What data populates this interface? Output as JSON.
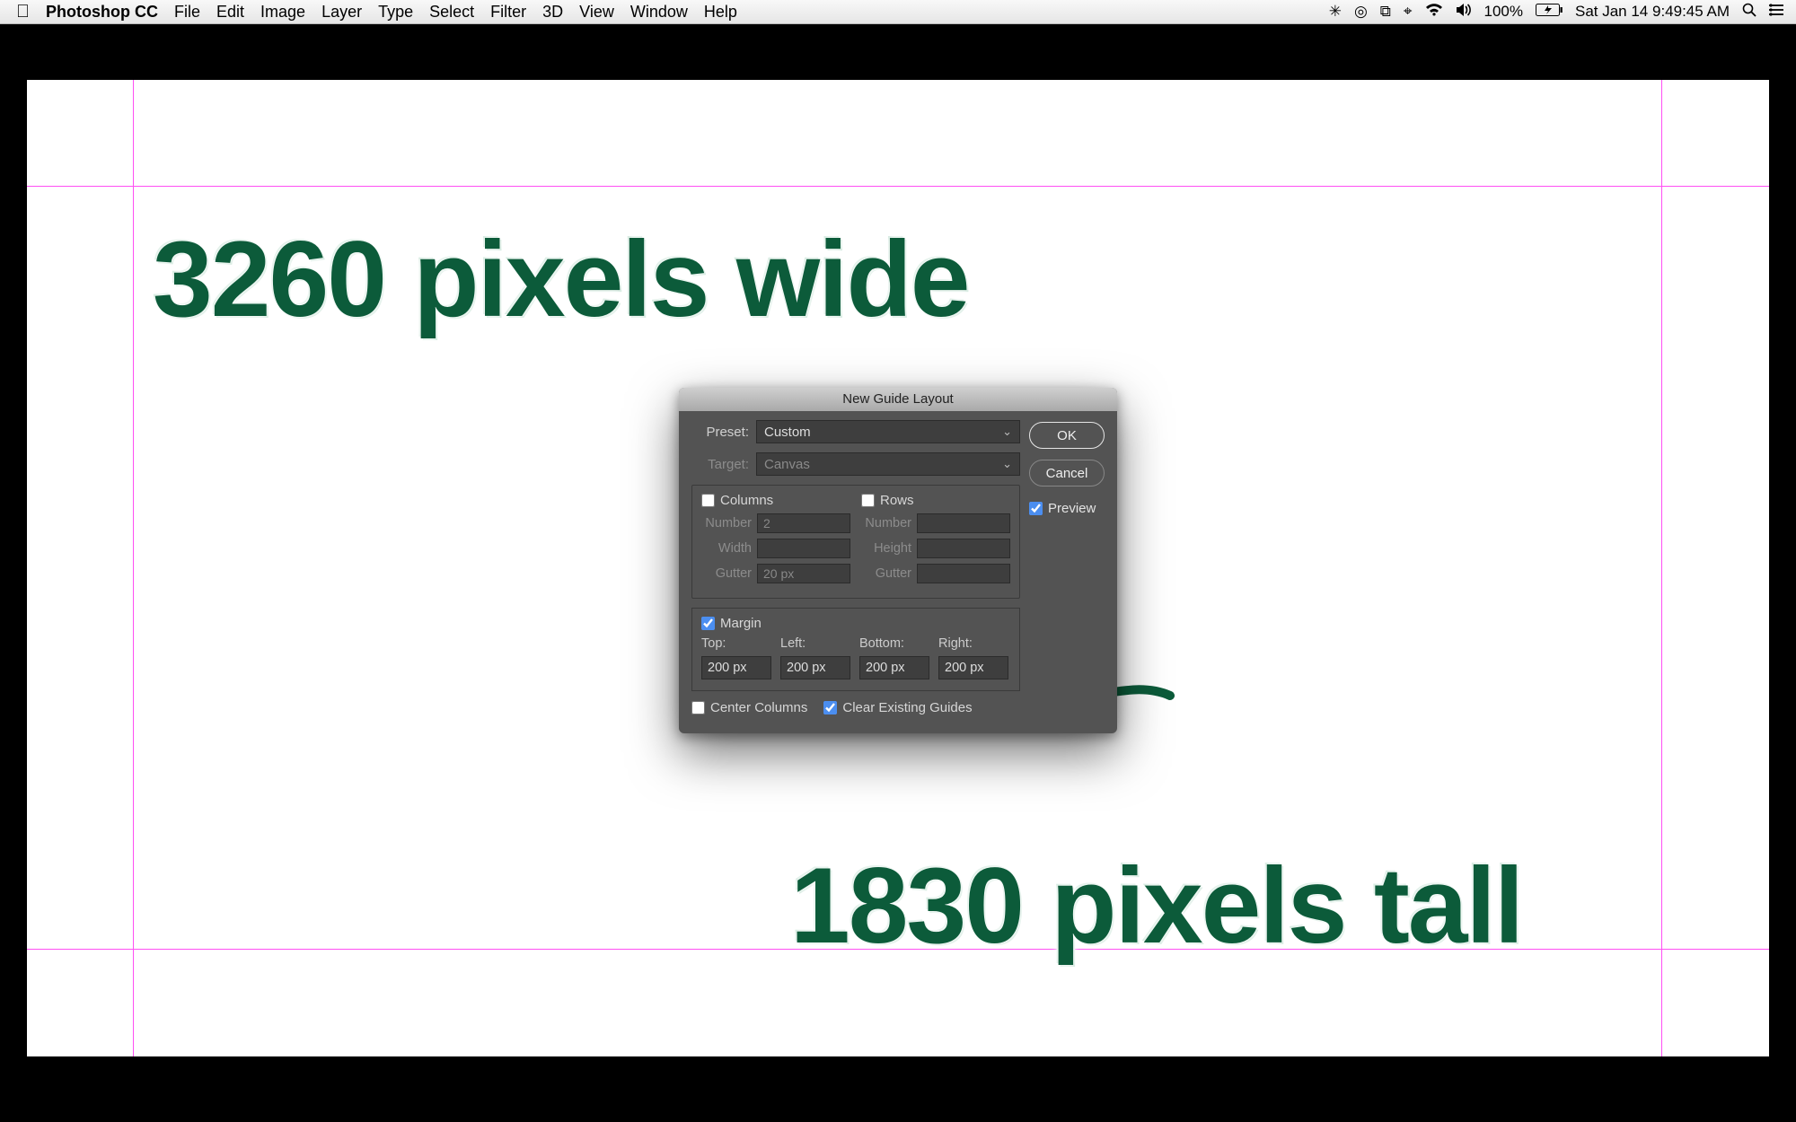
{
  "menubar": {
    "app": "Photoshop CC",
    "items": [
      "File",
      "Edit",
      "Image",
      "Layer",
      "Type",
      "Select",
      "Filter",
      "3D",
      "View",
      "Window",
      "Help"
    ],
    "battery_pct": "100%",
    "datetime": "Sat Jan 14  9:49:45 AM"
  },
  "annotations": {
    "wide": "3260 pixels wide",
    "tall": "1830 pixels tall"
  },
  "dialog": {
    "title": "New Guide Layout",
    "preset_label": "Preset:",
    "preset_value": "Custom",
    "target_label": "Target:",
    "target_value": "Canvas",
    "columns_label": "Columns",
    "rows_label": "Rows",
    "number_label": "Number",
    "width_label": "Width",
    "height_label": "Height",
    "gutter_label": "Gutter",
    "columns_number": "2",
    "columns_gutter": "20 px",
    "margin_label": "Margin",
    "m_top": "Top:",
    "m_left": "Left:",
    "m_bottom": "Bottom:",
    "m_right": "Right:",
    "m_top_v": "200 px",
    "m_left_v": "200 px",
    "m_bottom_v": "200 px",
    "m_right_v": "200 px",
    "center_cols": "Center Columns",
    "clear_exist": "Clear Existing Guides",
    "ok": "OK",
    "cancel": "Cancel",
    "preview": "Preview"
  }
}
